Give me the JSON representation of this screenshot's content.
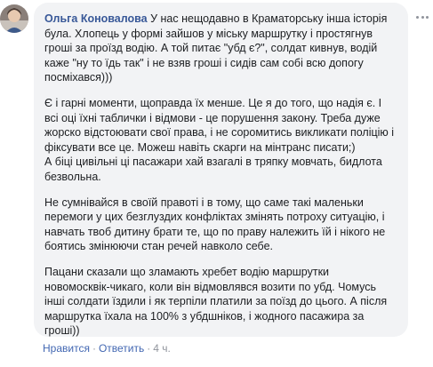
{
  "comment": {
    "author": "Ольга Коновалова",
    "paragraphs": [
      "У нас нещодавно в Краматорську інша історія була. Хлопець у формі зайшов у міську маршрутку і простягнув гроші за проїзд водію. А той питає \"убд є?\", солдат кивнув, водій каже \"ну то їдь так\" і не взяв гроші і сидів сам собі всю допогу посміхався)))",
      "Є і гарні моменти, щоправда їх менше. Це я до того, що надія є. І всі оці їхні таблички і відмови - це порушення закону. Треба дуже жорско відстоювати свої права, і не соромитись викликати поліцію і фіксувати все це. Можеш навіть скарги на мінтранс писати;)\nА біці цивільні ці пасажари хай взагалі в тряпку мовчать, бидлота безвольна.",
      "Не сумнівайся в своїй правоті і в тому, що саме такі маленьки перемоги у цих безглуздих конфліктах змінять потроху ситуацію, і навчать твоб дитину брати те, що по праву належить їй і нікого не боятись змінюючи стан речей навколо себе.",
      "Пацани сказали що зламають хребет водію маршрутки новомосквік-чикаго, коли він відмовлявся возити по убд. Чомусь інші солдати їздили і як терпіли платили за поїзд до цього. А після маршрутка їхала на 100% з убдшніков, і жодного пасажира за гроші))"
    ]
  },
  "actions": {
    "like": "Нравится",
    "reply": "Ответить",
    "time": "4 ч.",
    "separator": "·"
  },
  "icons": {
    "avatar": "user-avatar-photo",
    "more": "more-options-dots-icon"
  },
  "colors": {
    "author": "#385898",
    "link": "#4267b2",
    "bubble": "#f2f3f5",
    "meta": "#90949c"
  }
}
